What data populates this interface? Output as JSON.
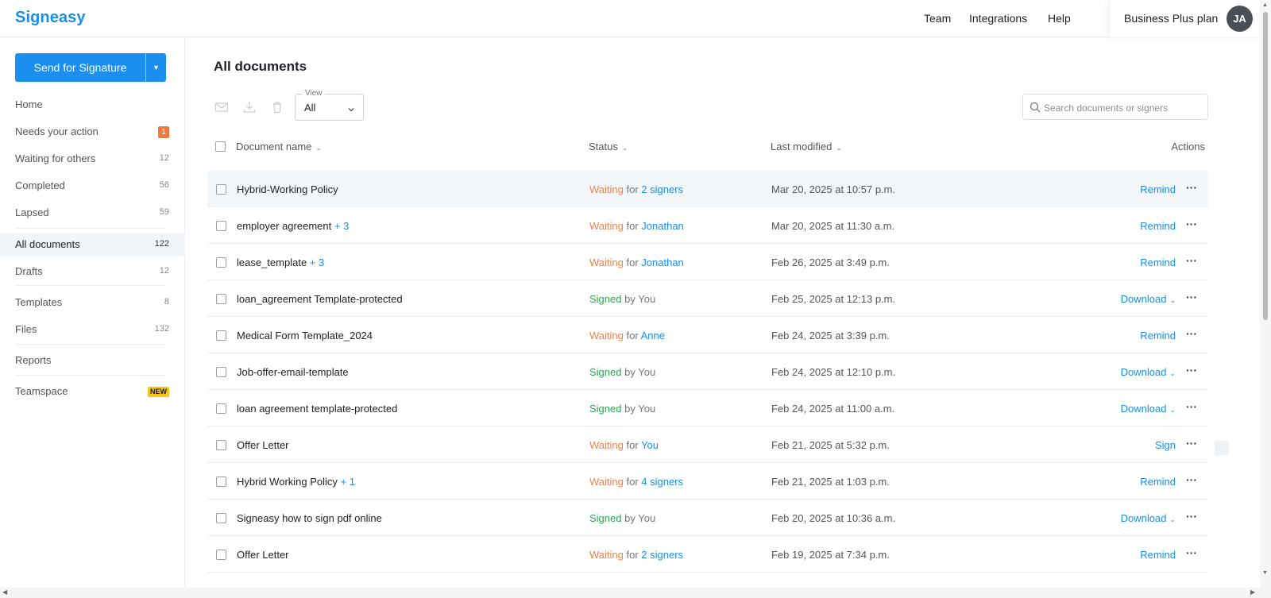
{
  "app": {
    "logo": "Signeasy",
    "nav": [
      "Team",
      "Integrations",
      "Help"
    ],
    "plan": "Business Plus plan",
    "avatar_initials": "JA"
  },
  "sidebar": {
    "send_button": "Send for Signature",
    "items": [
      {
        "label": "Home",
        "count": ""
      },
      {
        "label": "Needs your action",
        "count": "1"
      },
      {
        "label": "Waiting for others",
        "count": "12"
      },
      {
        "label": "Completed",
        "count": "56"
      },
      {
        "label": "Lapsed",
        "count": "59"
      },
      {
        "label": "All documents",
        "count": "122"
      },
      {
        "label": "Drafts",
        "count": "12"
      },
      {
        "label": "Templates",
        "count": "8"
      },
      {
        "label": "Files",
        "count": "132"
      },
      {
        "label": "Reports",
        "count": ""
      },
      {
        "label": "Teamspace",
        "count": "NEW"
      }
    ]
  },
  "main": {
    "title": "All documents",
    "view_label": "View",
    "view_value": "All",
    "search_placeholder": "Search documents or signers",
    "columns": {
      "name": "Document name",
      "status": "Status",
      "modified": "Last modified",
      "actions": "Actions"
    },
    "rows": [
      {
        "name": "Hybrid-Working Policy",
        "extra": "",
        "state": "Waiting",
        "conn": "for",
        "who": "2 signers",
        "date": "Mar 20, 2025 at 10:57 p.m.",
        "action": "Remind"
      },
      {
        "name": "employer agreement",
        "extra": "+ 3",
        "state": "Waiting",
        "conn": "for",
        "who": "Jonathan",
        "date": "Mar 20, 2025 at 11:30 a.m.",
        "action": "Remind"
      },
      {
        "name": "lease_template",
        "extra": "+ 3",
        "state": "Waiting",
        "conn": "for",
        "who": "Jonathan",
        "date": "Feb 26, 2025 at 3:49 p.m.",
        "action": "Remind"
      },
      {
        "name": "loan_agreement Template-protected",
        "extra": "",
        "state": "Signed",
        "conn": "by",
        "who": "You",
        "date": "Feb 25, 2025 at 12:13 p.m.",
        "action": "Download"
      },
      {
        "name": "Medical Form Template_2024",
        "extra": "",
        "state": "Waiting",
        "conn": "for",
        "who": "Anne",
        "date": "Feb 24, 2025 at 3:39 p.m.",
        "action": "Remind"
      },
      {
        "name": "Job-offer-email-template",
        "extra": "",
        "state": "Signed",
        "conn": "by",
        "who": "You",
        "date": "Feb 24, 2025 at 12:10 p.m.",
        "action": "Download"
      },
      {
        "name": "loan agreement template-protected",
        "extra": "",
        "state": "Signed",
        "conn": "by",
        "who": "You",
        "date": "Feb 24, 2025 at 11:00 a.m.",
        "action": "Download"
      },
      {
        "name": "Offer Letter",
        "extra": "",
        "state": "Waiting",
        "conn": "for",
        "who": "You",
        "date": "Feb 21, 2025 at 5:32 p.m.",
        "action": "Sign"
      },
      {
        "name": "Hybrid Working Policy",
        "extra": "+ 1",
        "state": "Waiting",
        "conn": "for",
        "who": "4 signers",
        "date": "Feb 21, 2025 at 1:03 p.m.",
        "action": "Remind"
      },
      {
        "name": "Signeasy how to sign pdf online",
        "extra": "",
        "state": "Signed",
        "conn": "by",
        "who": "You",
        "date": "Feb 20, 2025 at 10:36 a.m.",
        "action": "Download"
      },
      {
        "name": "Offer Letter",
        "extra": "",
        "state": "Waiting",
        "conn": "for",
        "who": "2 signers",
        "date": "Feb 19, 2025 at 7:34 p.m.",
        "action": "Remind"
      }
    ]
  },
  "colors": {
    "brand": "#1a8ee6",
    "primary_button": "#1b8ef0",
    "waiting": "#e8834e",
    "signed": "#2ea44f",
    "badge_action": "#f07a3c",
    "badge_new": "#f5c518"
  }
}
